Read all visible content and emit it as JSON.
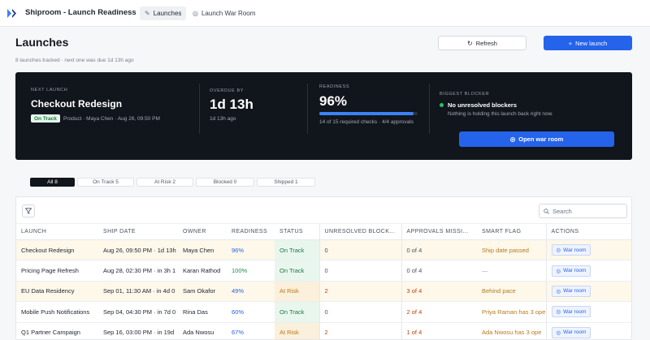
{
  "app": {
    "title": "Shiproom - Launch Readiness",
    "nav": [
      {
        "label": "Launches",
        "icon": "rocket-icon"
      },
      {
        "label": "Launch War Room",
        "icon": "target-icon"
      }
    ]
  },
  "page": {
    "title": "Launches",
    "subtitle": "8 launches tracked · next one was due 1d 13h ago",
    "refresh_label": "Refresh",
    "new_label": "New launch"
  },
  "hero": {
    "next_label": "NEXT LAUNCH",
    "next_name": "Checkout Redesign",
    "next_status": "On Track",
    "next_meta": "Product · Maya Chen · Aug 26, 09:50 PM",
    "overdue_label": "OVERDUE BY",
    "overdue_value": "1d 13h",
    "overdue_sub": "1d 13h ago",
    "readiness_label": "READINESS",
    "readiness_value": "96%",
    "readiness_fraction": 0.96,
    "readiness_sub": "14 of 15 required checks · 4/4 approvals",
    "blocker_label": "BIGGEST BLOCKER",
    "blocker_title": "No unresolved blockers",
    "blocker_sub": "Nothing is holding this launch back right now.",
    "war_room_label": "Open war room"
  },
  "filters": [
    "All 8",
    "On Track 5",
    "At Risk 2",
    "Blocked 0",
    "Shipped 1"
  ],
  "table": {
    "search_placeholder": "Search",
    "columns": [
      "LAUNCH",
      "SHIP DATE",
      "OWNER",
      "READINESS",
      "STATUS",
      "UNRESOLVED BLOCK...",
      "APPROVALS MISSI...",
      "SMART FLAG",
      "ACTIONS"
    ],
    "action_label": "War room",
    "rows": [
      {
        "launch": "Checkout Redesign",
        "ship": "Aug 26, 09:50 PM · 1d 13h",
        "owner": "Maya Chen",
        "readiness": "96%",
        "status": "On Track",
        "blockers": "0",
        "approvals": "0 of 4",
        "flag": "Ship date passed"
      },
      {
        "launch": "Pricing Page Refresh",
        "ship": "Aug 28, 02:30 PM · in 3h 1",
        "owner": "Karan Rathod",
        "readiness": "100%",
        "status": "On Track",
        "blockers": "0",
        "approvals": "0 of 4",
        "flag": "—"
      },
      {
        "launch": "EU Data Residency",
        "ship": "Sep 01, 11:30 AM · in 4d 0",
        "owner": "Sam Okafor",
        "readiness": "49%",
        "status": "At Risk",
        "blockers": "2",
        "approvals": "3 of 4",
        "flag": "Behind pace"
      },
      {
        "launch": "Mobile Push Notifications",
        "ship": "Sep 04, 04:30 PM · in 7d 0",
        "owner": "Rina Das",
        "readiness": "60%",
        "status": "On Track",
        "blockers": "0",
        "approvals": "2 of 4",
        "flag": "Priya Raman has 3 ope"
      },
      {
        "launch": "Q1 Partner Campaign",
        "ship": "Sep 16, 03:00 PM · in 19d",
        "owner": "Ada Nwosu",
        "readiness": "67%",
        "status": "At Risk",
        "blockers": "2",
        "approvals": "1 of 4",
        "flag": "Ada Nwosu has 3 ope"
      }
    ]
  }
}
